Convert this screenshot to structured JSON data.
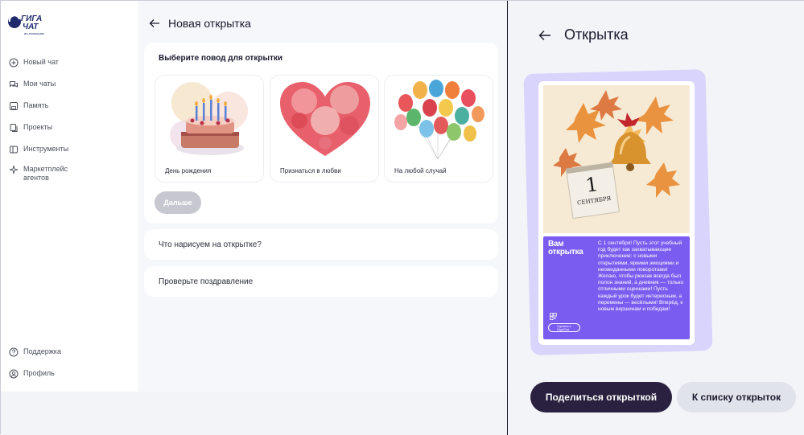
{
  "sidebar": {
    "logo_text": "ГИГА ЧАТ",
    "logo_sub": "ии-помощник",
    "items": [
      {
        "label": "Новый чат",
        "icon": "plus-circle-icon"
      },
      {
        "label": "Мои чаты",
        "icon": "chat-bubbles-icon"
      },
      {
        "label": "Память",
        "icon": "save-icon"
      },
      {
        "label": "Проекты",
        "icon": "documents-icon"
      },
      {
        "label": "Инструменты",
        "icon": "tools-icon"
      },
      {
        "label": "Маркетплейс агентов",
        "icon": "sparkle-icon"
      }
    ],
    "bottom_items": [
      {
        "label": "Поддержка",
        "icon": "help-circle-icon"
      },
      {
        "label": "Профиль",
        "icon": "user-circle-icon"
      }
    ]
  },
  "main": {
    "title": "Новая открытка",
    "panel_title": "Выберите повод для открытки",
    "occasions": [
      {
        "label": "День рождения",
        "art": "birthday-cake"
      },
      {
        "label": "Признаться в любви",
        "art": "watercolor-heart"
      },
      {
        "label": "На любой случай",
        "art": "balloons"
      }
    ],
    "next_label": "Дальше",
    "step2_label": "Что нарисуем на открытке?",
    "step3_label": "Проверьте поздравление"
  },
  "preview": {
    "title": "Открытка",
    "card_heading": "Вам открытка",
    "calendar_day": "1",
    "calendar_month": "СЕНТЯБРЯ",
    "greeting": "С 1 сентября! Пусть этот учебный год будет как захватывающее приключение: с новыми открытиями, яркими эмоциями и неожиданными поворотами! Желаю, чтобы рюкзак всегда был полон знаний, а дневник — только отличными оценками! Пусть каждый урок будет интересным, а перемены — весёлыми! Вперёд, к новым вершинам и победам!",
    "made_in": "Сделано в GigaChat",
    "share_label": "Поделиться открыткой",
    "list_label": "К списку открыток"
  },
  "colors": {
    "accent_purple": "#7b5cf0",
    "card_frame": "#d8d4fb",
    "share_button": "#2a2140",
    "secondary_button": "#e1e3ea",
    "disabled_button": "#c7c8cf"
  }
}
